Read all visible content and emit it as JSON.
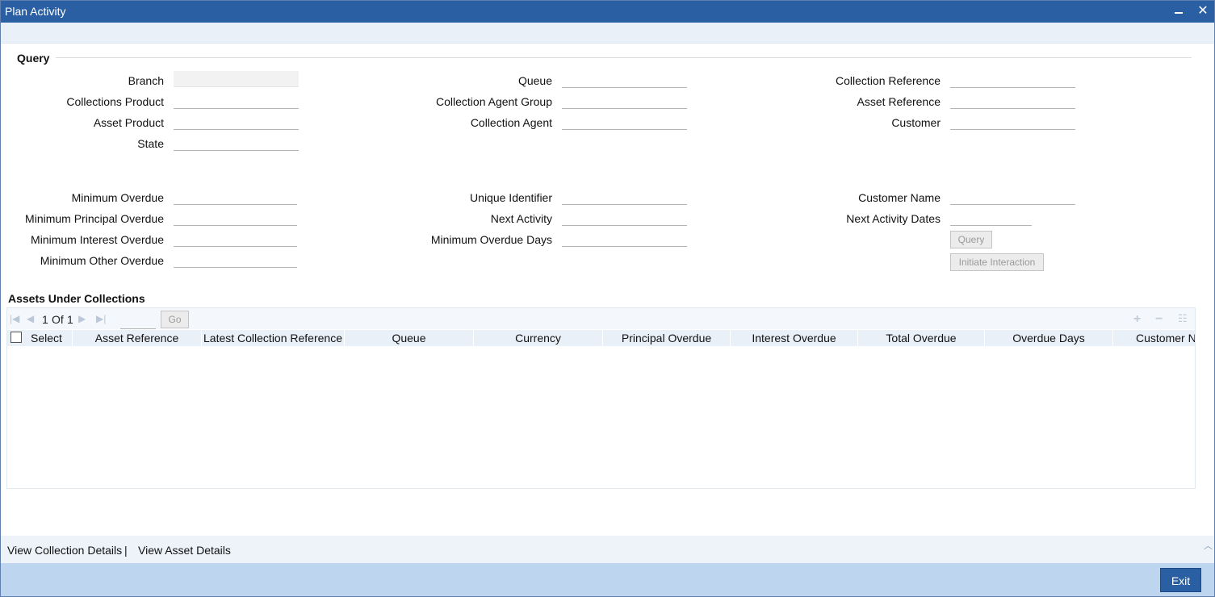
{
  "window": {
    "title": "Plan Activity"
  },
  "query": {
    "section_title": "Query",
    "col1": [
      {
        "label": "Branch",
        "value": ""
      },
      {
        "label": "Collections Product",
        "value": ""
      },
      {
        "label": "Asset Product",
        "value": ""
      },
      {
        "label": "State",
        "value": ""
      }
    ],
    "col2": [
      {
        "label": "Queue",
        "value": ""
      },
      {
        "label": "Collection Agent Group",
        "value": ""
      },
      {
        "label": "Collection Agent",
        "value": ""
      }
    ],
    "col3": [
      {
        "label": "Collection Reference",
        "value": ""
      },
      {
        "label": "Asset Reference",
        "value": ""
      },
      {
        "label": "Customer",
        "value": ""
      }
    ],
    "col1b": [
      {
        "label": "Minimum Overdue",
        "value": ""
      },
      {
        "label": "Minimum Principal Overdue",
        "value": ""
      },
      {
        "label": "Minimum Interest Overdue",
        "value": ""
      },
      {
        "label": "Minimum Other Overdue",
        "value": ""
      }
    ],
    "col2b": [
      {
        "label": "Unique Identifier",
        "value": ""
      },
      {
        "label": "Next Activity",
        "value": ""
      },
      {
        "label": "Minimum Overdue Days",
        "value": ""
      }
    ],
    "col3b": [
      {
        "label": "Customer Name",
        "value": ""
      },
      {
        "label": "Next Activity Dates",
        "value": ""
      }
    ],
    "query_button": "Query",
    "initiate_button": "Initiate Interaction"
  },
  "assets": {
    "section_title": "Assets Under Collections",
    "pager": {
      "current": "1",
      "of_label": "Of",
      "total": "1",
      "go_label": "Go"
    },
    "columns": [
      "Select",
      "Asset Reference",
      "Latest Collection Reference",
      "Queue",
      "Currency",
      "Principal Overdue",
      "Interest Overdue",
      "Total Overdue",
      "Overdue Days",
      "Customer Na"
    ],
    "rows": []
  },
  "links": {
    "view_collection": "View Collection Details",
    "separator": "|",
    "view_asset": "View Asset Details"
  },
  "footer": {
    "exit_label": "Exit"
  },
  "colors": {
    "titlebar": "#2b5fa3",
    "footer": "#bdd5ee",
    "header_row": "#e9f0f8"
  },
  "icons": [
    "minimize-icon",
    "close-icon",
    "first-page-icon",
    "prev-page-icon",
    "next-page-icon",
    "last-page-icon",
    "add-row-icon",
    "delete-row-icon",
    "single-view-icon",
    "scroll-up-icon"
  ]
}
